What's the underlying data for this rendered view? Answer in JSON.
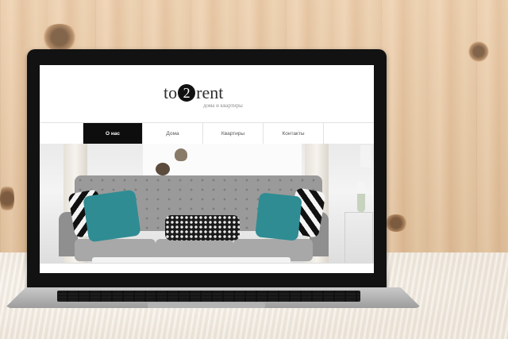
{
  "site": {
    "logo_left": "to",
    "logo_circle": "2",
    "logo_right": "rent",
    "tagline": "дома и квартиры"
  },
  "nav": {
    "items": [
      {
        "label": ""
      },
      {
        "label": "О нас"
      },
      {
        "label": "Дома"
      },
      {
        "label": "Квартиры"
      },
      {
        "label": "Контакты"
      },
      {
        "label": ""
      }
    ],
    "active_index": 1
  },
  "colors": {
    "nav_active_bg": "#0d0d0d",
    "pillow_teal": "#2f8c93",
    "wall_wood": "#eacba8"
  }
}
